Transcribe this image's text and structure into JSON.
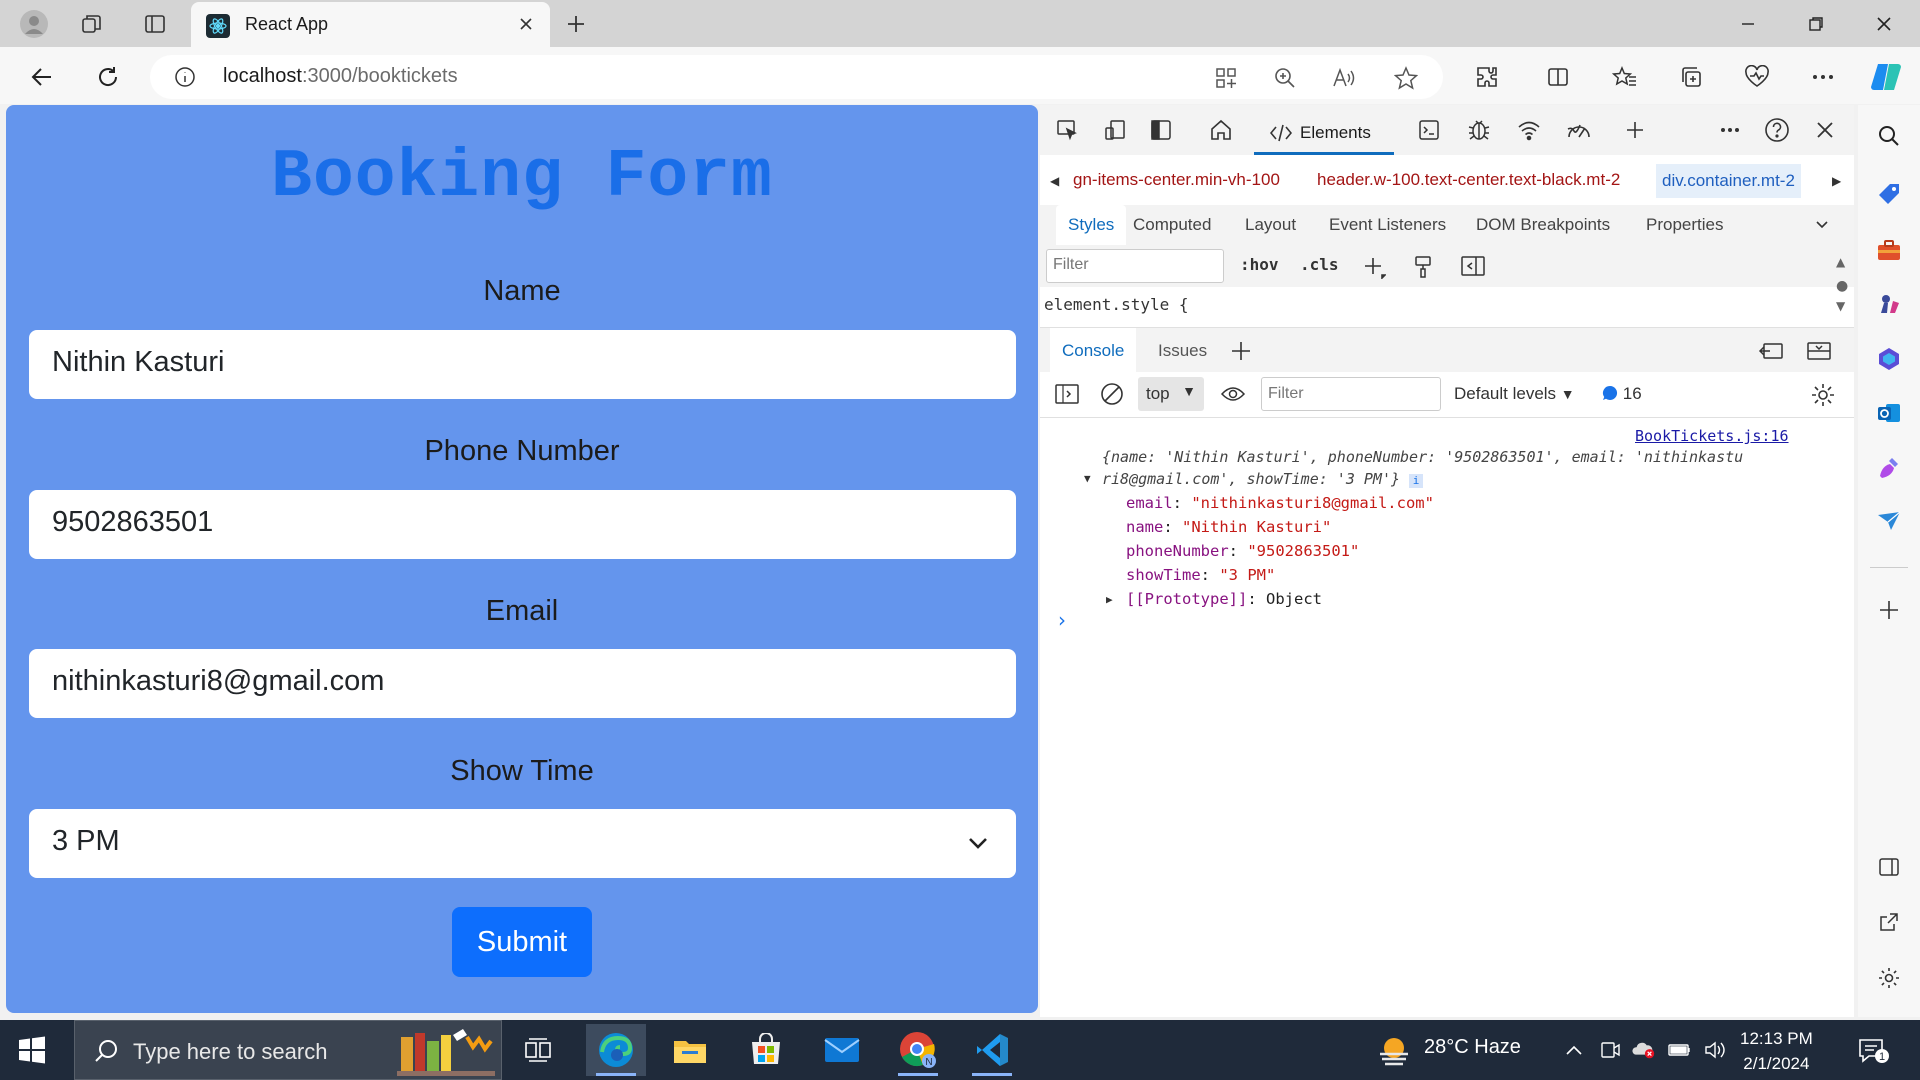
{
  "browser": {
    "tab_title": "React App",
    "url_host": "localhost",
    "url_path": ":3000/booktickets"
  },
  "page": {
    "title": "Booking Form",
    "fields": [
      {
        "label": "Name",
        "value": "Nithin Kasturi"
      },
      {
        "label": "Phone Number",
        "value": "9502863501"
      },
      {
        "label": "Email",
        "value": "nithinkasturi8@gmail.com"
      }
    ],
    "select": {
      "label": "Show Time",
      "value": "3 PM"
    },
    "submit_label": "Submit",
    "bg_color": "#6495ed",
    "title_color": "#1a6ee8",
    "button_color": "#0d6efd"
  },
  "devtools": {
    "elements_tab": "Elements",
    "breadcrumbs": [
      "gn-items-center.min-vh-100",
      "header.w-100.text-center.text-black.mt-2",
      "div.container.mt-2"
    ],
    "subtabs": [
      "Styles",
      "Computed",
      "Layout",
      "Event Listeners",
      "DOM Breakpoints",
      "Properties"
    ],
    "filter_placeholder": "Filter",
    "hov": ":hov",
    "cls": ".cls",
    "element_style": "element.style {",
    "console_tabs": [
      "Console",
      "Issues"
    ],
    "context": "top",
    "console_filter_placeholder": "Filter",
    "levels": "Default levels",
    "message_count": "16",
    "log": {
      "source": "BookTickets.js:16",
      "summary_1": "{name: 'Nithin Kasturi', phoneNumber: '9502863501', email: 'nithinkastu",
      "summary_2": "ri8@gmail.com', showTime: '3 PM'}",
      "props": [
        {
          "key": "email",
          "value": "\"nithinkasturi8@gmail.com\""
        },
        {
          "key": "name",
          "value": "\"Nithin Kasturi\""
        },
        {
          "key": "phoneNumber",
          "value": "\"9502863501\""
        },
        {
          "key": "showTime",
          "value": "\"3 PM\""
        }
      ],
      "prototype_key": "[[Prototype]]",
      "prototype_value": "Object"
    }
  },
  "taskbar": {
    "search_placeholder": "Type here to search",
    "weather": "28°C  Haze",
    "time": "12:13 PM",
    "date": "2/1/2024"
  },
  "icons": [
    "profile-icon",
    "workspaces-icon",
    "tab-actions-icon",
    "react-icon",
    "back-icon",
    "refresh-icon",
    "info-icon",
    "apps-icon",
    "zoom-icon",
    "read-aloud-icon",
    "favorite-icon",
    "extensions-icon",
    "split-screen-icon",
    "favorites-icon",
    "collections-icon",
    "browser-essentials-icon",
    "more-icon",
    "copilot-icon",
    "windows-start-icon",
    "edge-icon",
    "file-explorer-icon",
    "store-icon",
    "mail-icon",
    "chrome-icon",
    "vscode-icon"
  ]
}
